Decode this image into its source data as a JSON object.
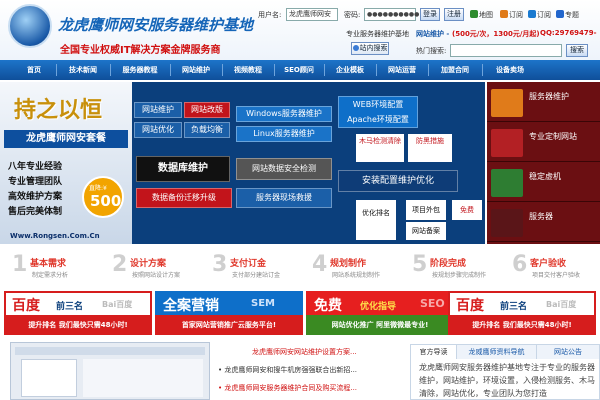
{
  "header": {
    "site_title": "龙虎鹰师网安服务器维护基地",
    "slogan": "全国专业权威IT解决方案金牌服务商",
    "username_label": "用户名:",
    "username_value": "龙虎鹰师网安",
    "password_label": "密码:",
    "password_value": "●●●●●●●●●●",
    "login_button": "登录",
    "register_button": "注册",
    "links": [
      {
        "icon": "map-icon",
        "label": "地图",
        "color": "#2e8b2e"
      },
      {
        "icon": "rss-icon",
        "label": "订阅",
        "color": "#e07b1a"
      },
      {
        "icon": "topic-icon",
        "label": "专题",
        "color": "#2266cc"
      }
    ],
    "promo_prefix": "专业服务器维护基地",
    "promo_price_label": "网站维护 -",
    "promo_price": "(500元/次，1300元/月起)",
    "promo_qq": "QQ:29769479-",
    "search_button": "站内搜索",
    "hot_search_label": "热门搜索:",
    "search_submit": "搜索"
  },
  "nav": [
    "首页",
    "技术新闻",
    "服务器教程",
    "网站维护",
    "视频教程",
    "SEO顾问",
    "企业模板",
    "网站运营",
    "加盟合同",
    "设备卖场"
  ],
  "banner": {
    "slogan_big": "持之以恒",
    "company": "龙虎鹰师网安套餐",
    "points": [
      "八年专业经验",
      "专业管理团队",
      "高效维护方案",
      "售后完美体制"
    ],
    "price_prefix": "直降:¥",
    "price": "500",
    "url": "Www.Rongsen.Com.Cn",
    "tiles": {
      "t1": "网站维护",
      "t2": "网站改版",
      "t3": "Windows服务器维护",
      "t4": "网站优化",
      "t5": "负载均衡",
      "t6": "Linux服务器维护",
      "t7": "数据库维护",
      "t8": "网站数据安全检测",
      "t9": "数据备份迁移升级",
      "t10": "服务器现场救援",
      "t11": "WEB环境配置",
      "t12": "Apache环境配置",
      "t13": "木马检测清除",
      "t14": "防黑措施",
      "t15": "安装配置维护优化",
      "t16": "优化排名",
      "t17": "项目外包",
      "t18": "网站备案",
      "t19": "免费"
    }
  },
  "side_banner": [
    "服务器维护",
    "专业定制网站",
    "稳定虚机",
    "服务器"
  ],
  "steps": [
    {
      "num": "1",
      "title": "基本需求",
      "sub": "制定需求分析"
    },
    {
      "num": "2",
      "title": "设计方案",
      "sub": "按照网站设计方案"
    },
    {
      "num": "3",
      "title": "支付订金",
      "sub": "支付部分建站订金"
    },
    {
      "num": "4",
      "title": "规划制作",
      "sub": "网站系统规划制作"
    },
    {
      "num": "5",
      "title": "阶段完成",
      "sub": "按规划步骤完成制作"
    },
    {
      "num": "6",
      "title": "客户验收",
      "sub": "项目交付客户验收"
    }
  ],
  "ads": [
    {
      "big": "百度",
      "mid": "前三名",
      "tag": "Bai百度",
      "bottom": "提升排名 我们最快只需48小时!"
    },
    {
      "big": "全案营销",
      "mid": "SEM",
      "tag": "",
      "bottom": "首家网站营销推广云服务平台!"
    },
    {
      "big": "免费",
      "mid": "优化指导",
      "tag": "SEO",
      "bottom": "网站优化推广 阿里微微最专业!"
    },
    {
      "big": "百度",
      "mid": "前三名",
      "tag": "Bai百度",
      "bottom": "提升排名 我们最快只需48小时!"
    }
  ],
  "news": [
    {
      "text": "龙虎鹰师网安网站维护设置方案...",
      "color": "#d01010"
    },
    {
      "text": "龙虎鹰师网安和搜牛机房强强联合出新招...",
      "color": "#333333"
    },
    {
      "text": "龙虎鹰师网安服务器维护合同及购买流程...",
      "color": "#d01010"
    }
  ],
  "tabs": [
    "官方导读",
    "龙威鹰师资料导航",
    "网站公告"
  ],
  "tab_body": "龙虎鹰师网安服务器维护基地专注于专业的服务器维护，网站维护，环境设置，入侵检测服务、木马清除，网站优化，专业团队为您打造"
}
